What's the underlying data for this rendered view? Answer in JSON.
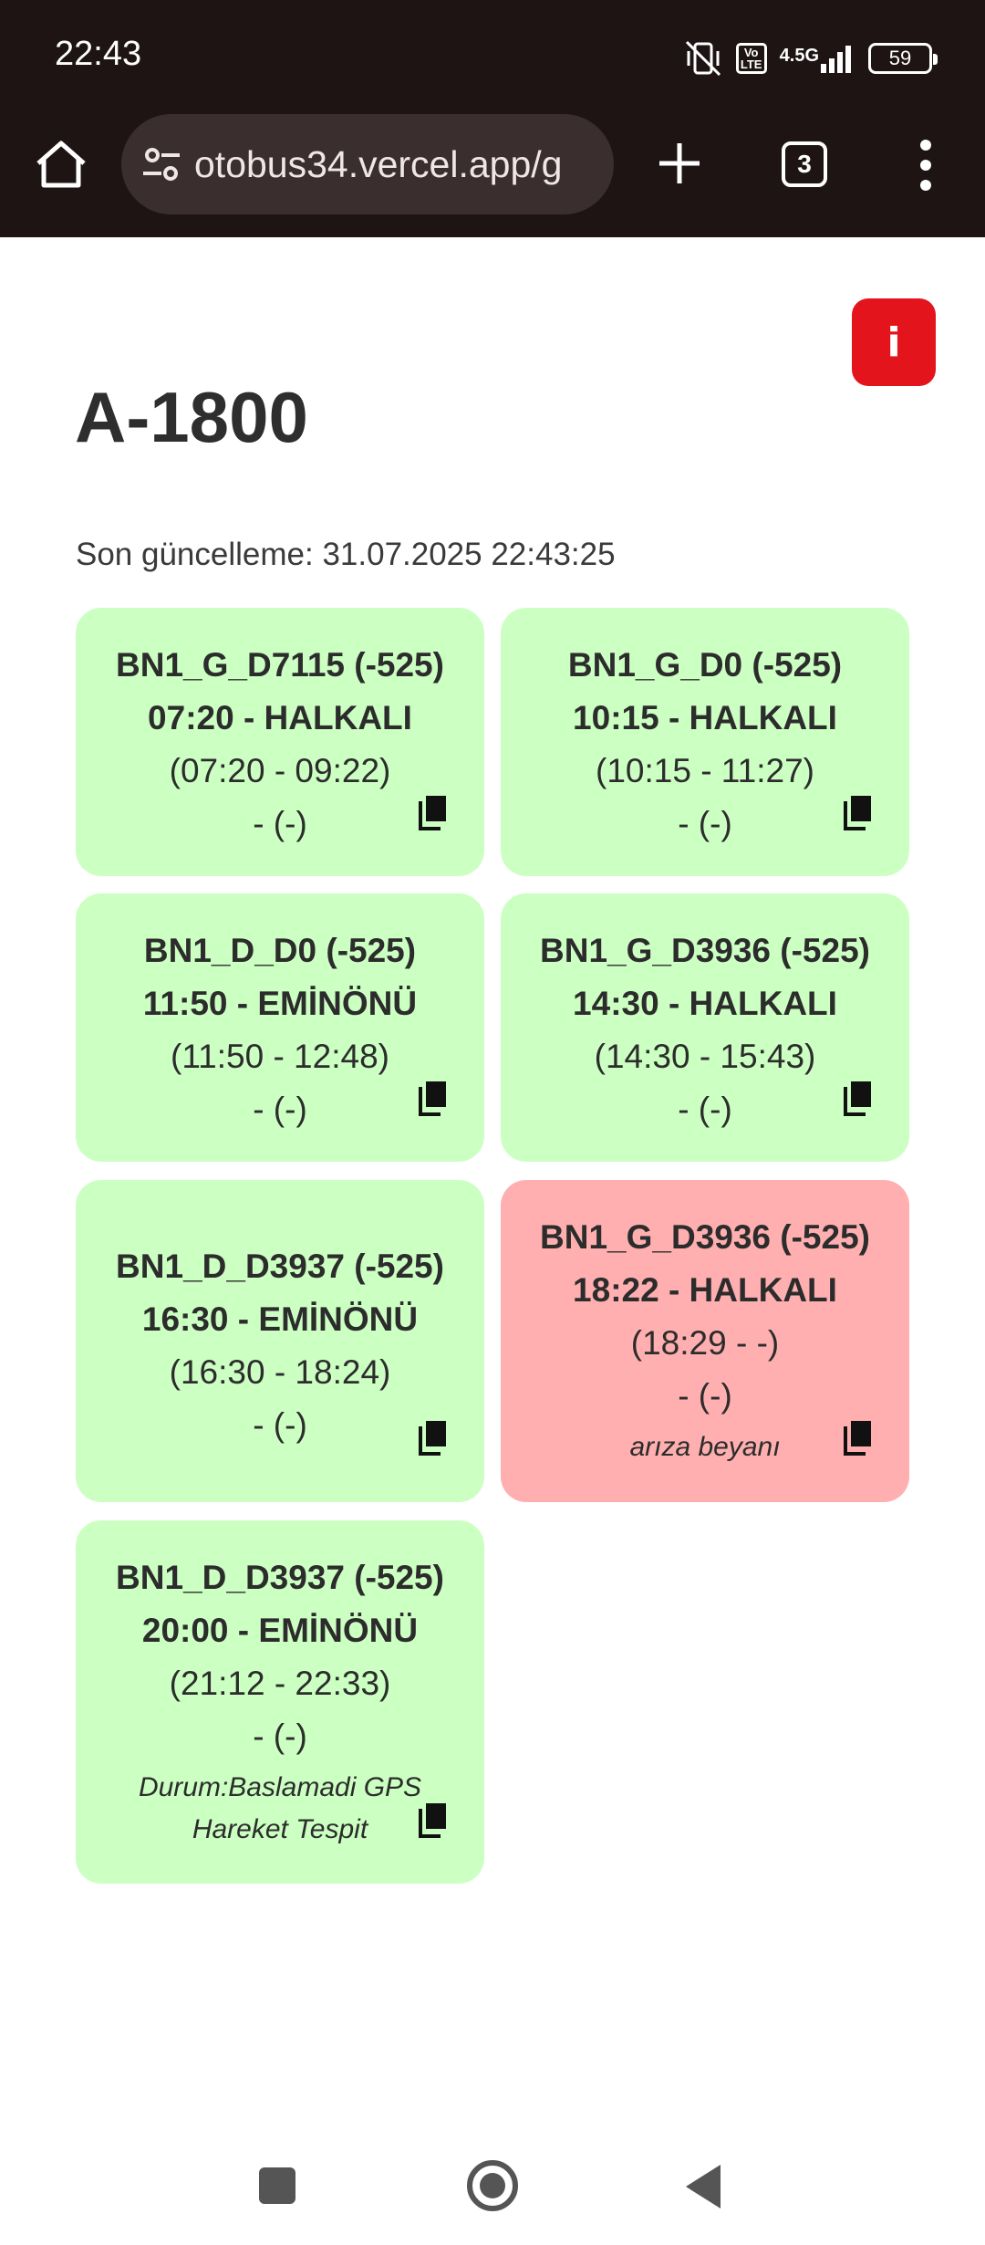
{
  "status_bar": {
    "time": "22:43",
    "volte_label": "Vo LTE",
    "network_label": "4.5G",
    "battery_level": "59"
  },
  "browser": {
    "url": "otobus34.vercel.app/g",
    "tab_count": "3"
  },
  "page": {
    "info_label": "i",
    "title": "A-1800",
    "last_updated_label": "Son güncelleme: 31.07.2025 22:43:25",
    "accent_color": "#e3141c",
    "ok_color": "#ccffc2",
    "alert_color": "#ffafaf"
  },
  "trips": [
    {
      "code": "BN1_G_D7115 (-525)",
      "departure": "07:20 - HALKALI",
      "window": "(07:20 - 09:22)",
      "extra": "- (-)",
      "note": "",
      "status": "ok"
    },
    {
      "code": "BN1_G_D0 (-525)",
      "departure": "10:15 - HALKALI",
      "window": "(10:15 - 11:27)",
      "extra": "- (-)",
      "note": "",
      "status": "ok"
    },
    {
      "code": "BN1_D_D0 (-525)",
      "departure": "11:50 - EMİNÖNÜ",
      "window": "(11:50 - 12:48)",
      "extra": "- (-)",
      "note": "",
      "status": "ok"
    },
    {
      "code": "BN1_G_D3936 (-525)",
      "departure": "14:30 - HALKALI",
      "window": "(14:30 - 15:43)",
      "extra": "- (-)",
      "note": "",
      "status": "ok"
    },
    {
      "code": "BN1_D_D3937 (-525)",
      "departure": "16:30 - EMİNÖNÜ",
      "window": "(16:30 - 18:24)",
      "extra": "- (-)",
      "note": "",
      "status": "ok"
    },
    {
      "code": "BN1_G_D3936 (-525)",
      "departure": "18:22 - HALKALI",
      "window": "(18:29 - -)",
      "extra": "- (-)",
      "note": "arıza beyanı",
      "status": "alert"
    },
    {
      "code": "BN1_D_D3937 (-525)",
      "departure": "20:00 - EMİNÖNÜ",
      "window": "(21:12 - 22:33)",
      "extra": "- (-)",
      "note": "Durum:Baslamadi GPS Hareket Tespit",
      "status": "ok"
    }
  ]
}
